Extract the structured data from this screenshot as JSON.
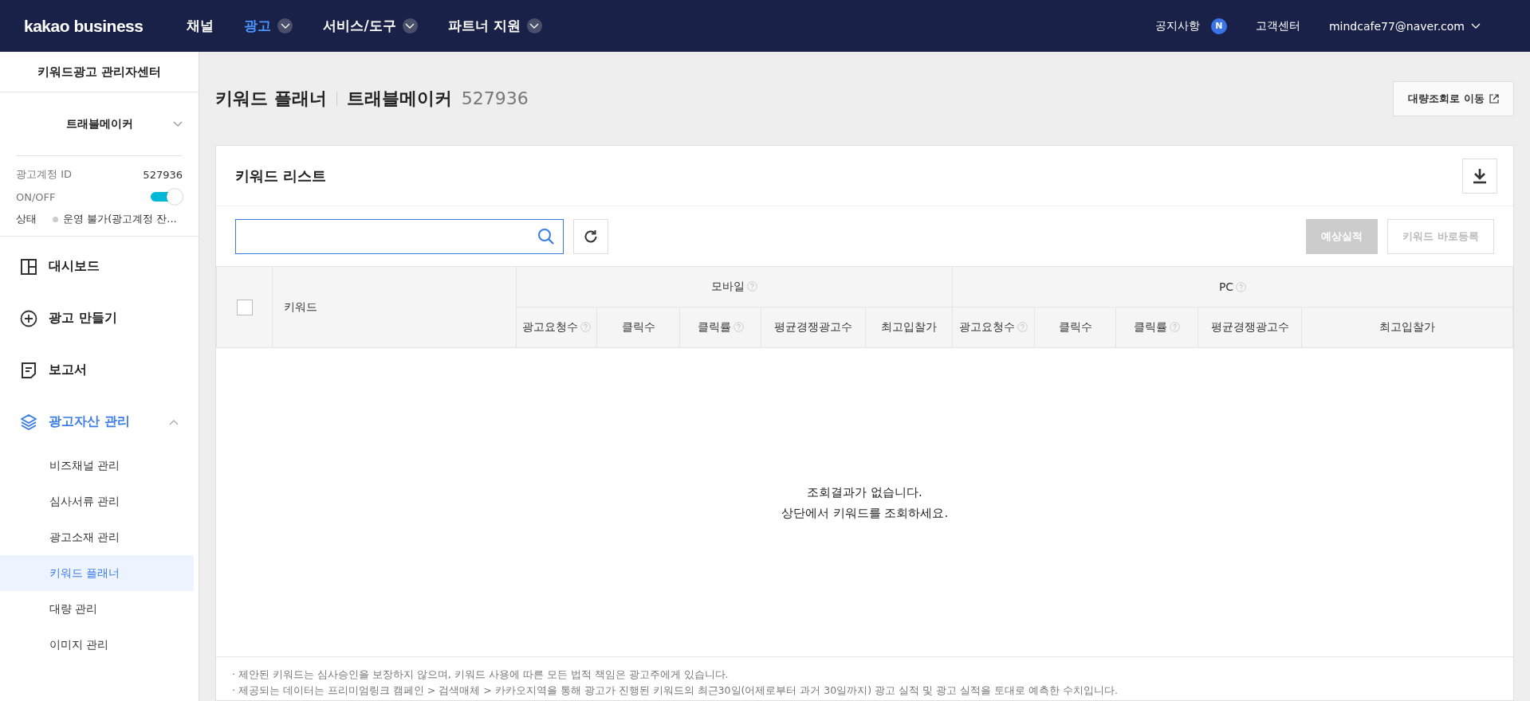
{
  "topbar": {
    "logo": "kakao business",
    "nav": [
      {
        "label": "채널",
        "selected": false,
        "dropdown": false
      },
      {
        "label": "광고",
        "selected": true,
        "dropdown": true
      },
      {
        "label": "서비스/도구",
        "selected": false,
        "dropdown": true
      },
      {
        "label": "파트너 지원",
        "selected": false,
        "dropdown": true
      }
    ],
    "notice": "공지사항",
    "notice_badge": "N",
    "help": "고객센터",
    "account": "mindcafe77@naver.com"
  },
  "sidebar": {
    "title": "키워드광고 관리자센터",
    "account_name": "트래블메이커",
    "info": [
      {
        "label": "광고계정 ID",
        "value": "527936"
      }
    ],
    "toggle": {
      "label": "ON/OFF",
      "on": true
    },
    "status": {
      "label": "상태",
      "value": "운영 불가(광고계정 잔..."
    },
    "menu": [
      {
        "label": "대시보드",
        "kind": "dashboard",
        "selected": false
      },
      {
        "label": "광고 만들기",
        "kind": "plus",
        "selected": false
      },
      {
        "label": "보고서",
        "kind": "report",
        "selected": false
      },
      {
        "label": "광고자산 관리",
        "kind": "layers",
        "selected": true,
        "expanded": true,
        "children": [
          {
            "label": "비즈채널 관리",
            "selected": false
          },
          {
            "label": "심사서류 관리",
            "selected": false
          },
          {
            "label": "광고소재 관리",
            "selected": false
          },
          {
            "label": "키워드 플래너",
            "selected": true
          },
          {
            "label": "대량 관리",
            "selected": false
          },
          {
            "label": "이미지 관리",
            "selected": false
          }
        ]
      }
    ]
  },
  "page": {
    "title": "키워드 플래너",
    "account": "트래블메이커",
    "account_id": "527936",
    "bulk_button": "대량조회로 이동"
  },
  "card": {
    "title": "키워드 리스트",
    "buttons": [
      {
        "label": "예상실적",
        "disabled": true,
        "kind": "primary"
      },
      {
        "label": "키워드 바로등록",
        "disabled": true,
        "kind": "secondary"
      }
    ],
    "table": {
      "select_all": false,
      "keyword_column": "키워드",
      "groups": [
        {
          "label": "모바일",
          "columns": [
            {
              "label": "광고요청수",
              "help": true
            },
            {
              "label": "클릭수",
              "help": false
            },
            {
              "label": "클릭률",
              "help": true
            },
            {
              "label": "평균경쟁광고수",
              "help": false
            },
            {
              "label": "최고입찰가",
              "help": false
            }
          ]
        },
        {
          "label": "PC",
          "columns": [
            {
              "label": "광고요청수",
              "help": true
            },
            {
              "label": "클릭수",
              "help": false
            },
            {
              "label": "클릭률",
              "help": true
            },
            {
              "label": "평균경쟁광고수",
              "help": false
            },
            {
              "label": "최고입찰가",
              "help": false
            }
          ]
        }
      ],
      "empty": [
        "조회결과가 없습니다.",
        "상단에서 키워드를 조회하세요."
      ]
    },
    "note_bullet": "·",
    "notes": [
      "제안된 키워드는 심사승인을 보장하지 않으며, 키워드 사용에 따른 모든 법적 책임은 광고주에게 있습니다.",
      "제공되는 데이터는 프리미엄링크 캠페인 > 검색매체 > 카카오지역을 통해 광고가 진행된 키워드의 최근30일(어제로부터 과거 30일까지) 광고 실적 및 광고 실적을 토대로 예측한 수치입니다."
    ]
  }
}
